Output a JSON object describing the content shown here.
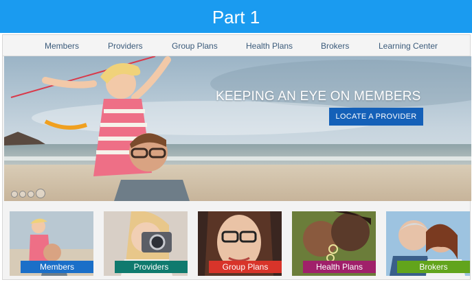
{
  "banner": {
    "title": "Part 1"
  },
  "nav": {
    "items": [
      "Members",
      "Providers",
      "Group Plans",
      "Health Plans",
      "Brokers",
      "Learning Center"
    ]
  },
  "hero": {
    "headline": "KEEPING AN EYE ON MEMBERS",
    "cta": "LOCATE A PROVIDER",
    "slide_count": 4,
    "active_slide": 4
  },
  "tiles": [
    {
      "label": "Members",
      "color": "#1b6fc8"
    },
    {
      "label": "Providers",
      "color": "#0f7a6e"
    },
    {
      "label": "Group Plans",
      "color": "#d8342a"
    },
    {
      "label": "Health Plans",
      "color": "#a0206a"
    },
    {
      "label": "Brokers",
      "color": "#62a41c"
    }
  ],
  "colors": {
    "banner": "#1a9bf0",
    "cta": "#1460b8"
  }
}
